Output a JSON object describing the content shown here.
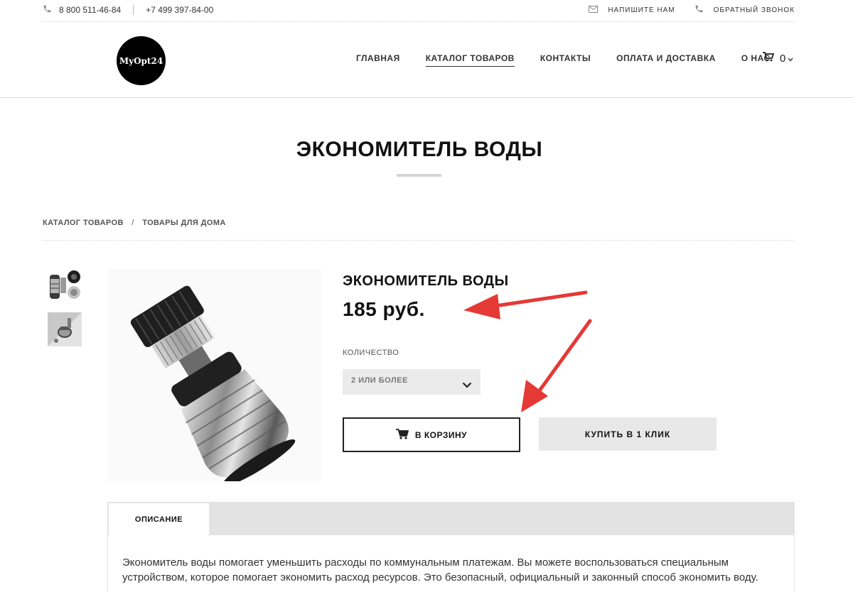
{
  "topbar": {
    "phone1": "8 800 511-46-84",
    "phone2": "+7 499 397-84-00",
    "write_us": "НАПИШИТЕ НАМ",
    "callback": "ОБРАТНЫЙ ЗВОНОК"
  },
  "logo": {
    "text": "MyOpt24"
  },
  "nav": {
    "items": [
      "ГЛАВНАЯ",
      "КАТАЛОГ ТОВАРОВ",
      "КОНТАКТЫ",
      "ОПЛАТА И ДОСТАВКА",
      "О НАС"
    ],
    "active": "КАТАЛОГ ТОВАРОВ"
  },
  "cart": {
    "count": "0"
  },
  "page": {
    "title": "ЭКОНОМИТЕЛЬ ВОДЫ"
  },
  "breadcrumb": {
    "items": [
      "КАТАЛОГ ТОВАРОВ",
      "ТОВАРЫ ДЛЯ ДОМА"
    ],
    "separator": "/"
  },
  "product": {
    "name": "ЭКОНОМИТЕЛЬ ВОДЫ",
    "price": "185 руб.",
    "qty_label": "КОЛИЧЕСТВО",
    "qty_value": "2 ИЛИ БОЛЕЕ",
    "add_to_cart": "В КОРЗИНУ",
    "buy_one_click": "КУПИТЬ В 1 КЛИК"
  },
  "tabs": {
    "description": "ОПИСАНИЕ"
  },
  "description": {
    "text": "Экономитель воды помогает уменьшить расходы по коммунальным платежам. Вы можете воспользоваться специальным устройством, которое помогает экономить расход ресурсов. Это безопасный, официальный и законный способ экономить воду."
  },
  "colors": {
    "arrow": "#e53935",
    "accent": "#222222"
  }
}
